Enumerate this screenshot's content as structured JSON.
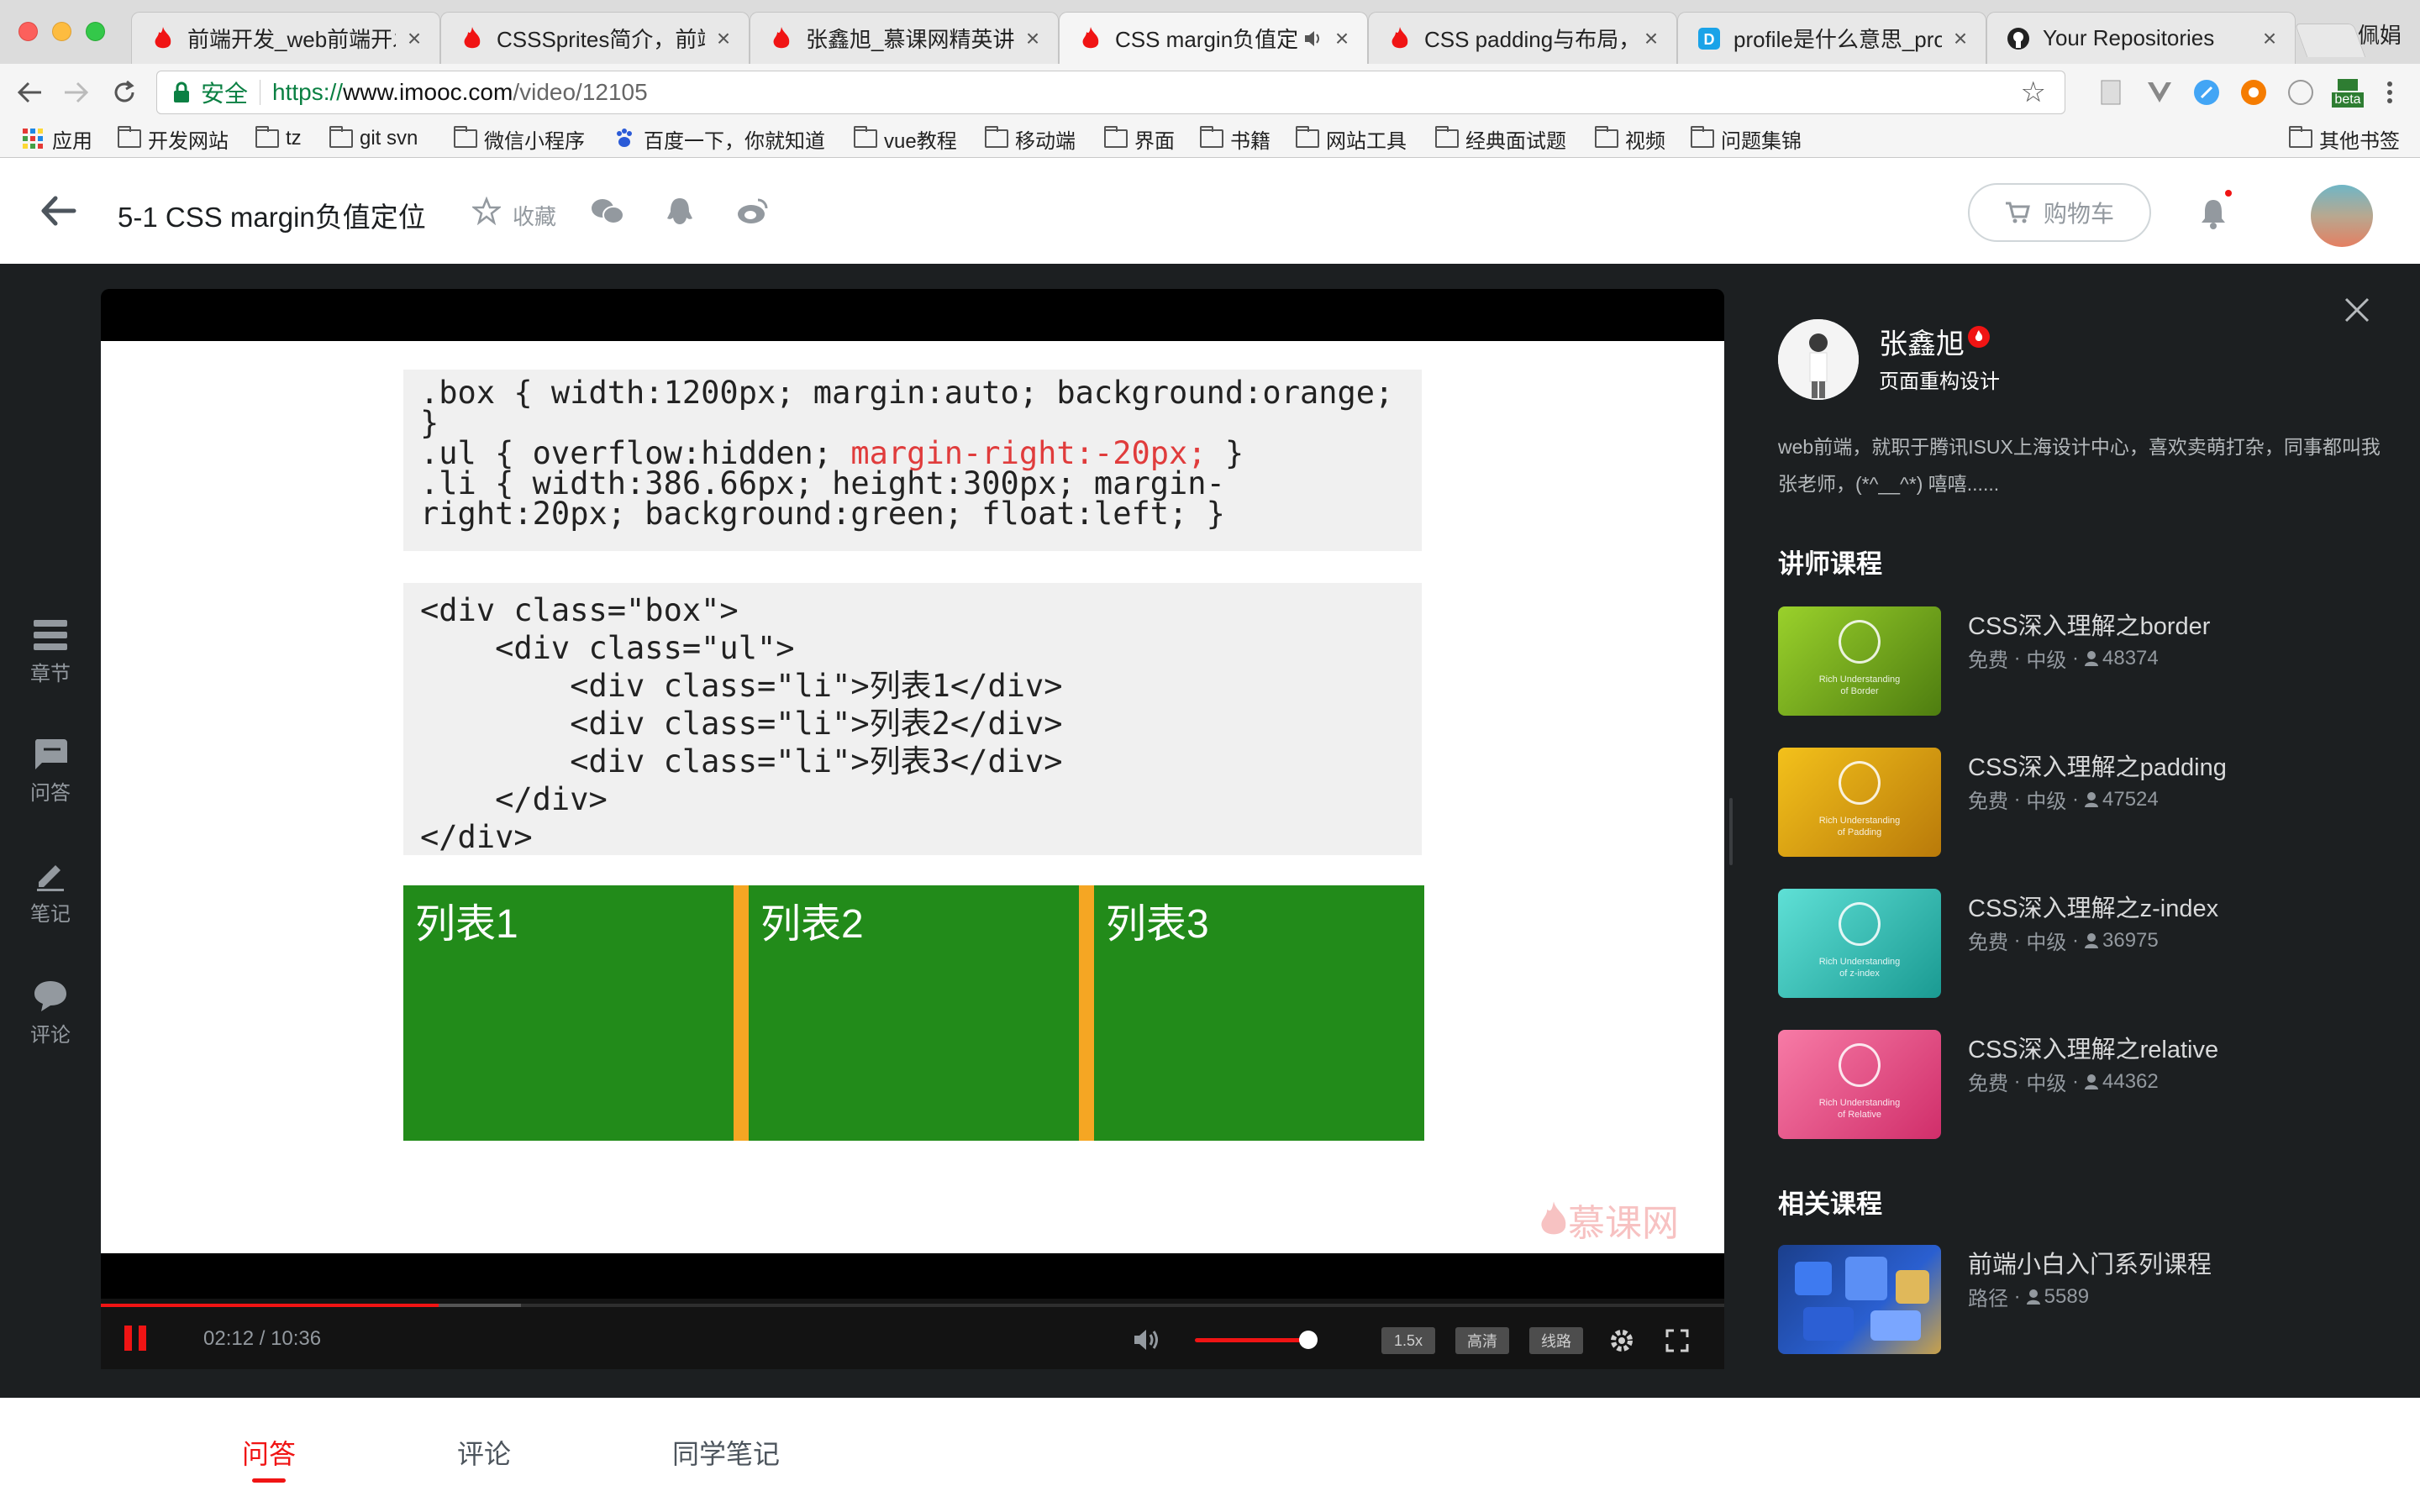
{
  "browser": {
    "tabs": [
      {
        "title": "前端开发_web前端开发",
        "favicon": "imooc-flame-icon"
      },
      {
        "title": "CSSSprites简介，前端",
        "favicon": "imooc-flame-icon"
      },
      {
        "title": "张鑫旭_慕课网精英讲师",
        "favicon": "imooc-flame-icon"
      },
      {
        "title": "CSS margin负值定位",
        "favicon": "imooc-flame-icon",
        "active": true,
        "audio": "speaker-icon"
      },
      {
        "title": "CSS padding与布局，C",
        "favicon": "imooc-flame-icon"
      },
      {
        "title": "profile是什么意思_profi",
        "favicon": "dict-icon"
      },
      {
        "title": "Your Repositories",
        "favicon": "github-icon"
      }
    ],
    "tab_close": "×",
    "profile_name": "佩娟",
    "address": {
      "secure_label": "安全",
      "scheme": "https://",
      "host": "www.imooc.com",
      "path": "/video/12105"
    },
    "extension_badge": "beta",
    "bookmarks": [
      {
        "label": "应用",
        "icon": "apps-grid-icon"
      },
      {
        "label": "开发网站",
        "icon": "folder-icon"
      },
      {
        "label": "tz",
        "icon": "folder-icon"
      },
      {
        "label": "git svn",
        "icon": "folder-icon"
      },
      {
        "label": "微信小程序",
        "icon": "folder-icon"
      },
      {
        "label": "百度一下，你就知道",
        "icon": "baidu-paw-icon"
      },
      {
        "label": "vue教程",
        "icon": "folder-icon"
      },
      {
        "label": "移动端",
        "icon": "folder-icon"
      },
      {
        "label": "界面",
        "icon": "folder-icon"
      },
      {
        "label": "书籍",
        "icon": "folder-icon"
      },
      {
        "label": "网站工具",
        "icon": "folder-icon"
      },
      {
        "label": "经典面试题",
        "icon": "folder-icon"
      },
      {
        "label": "视频",
        "icon": "folder-icon"
      },
      {
        "label": "问题集锦",
        "icon": "folder-icon"
      }
    ],
    "other_bookmarks": "其他书签"
  },
  "header": {
    "course_title": "5-1 CSS margin负值定位",
    "collect_label": "收藏",
    "cart_label": "购物车"
  },
  "sidebar": {
    "items": [
      {
        "label": "章节",
        "icon": "chapters-icon"
      },
      {
        "label": "问答",
        "icon": "qa-icon"
      },
      {
        "label": "笔记",
        "icon": "note-pen-icon"
      },
      {
        "label": "评论",
        "icon": "comment-bubble-icon"
      }
    ]
  },
  "slide": {
    "code_css": {
      "line1": ".box { width:1200px; margin:auto; background:orange;",
      "line2": "}",
      "line3_pre": ".ul { overflow:hidden; ",
      "line3_red": "margin-right:-20px;",
      "line3_post": " }",
      "line4": ".li { width:386.66px; height:300px; margin-",
      "line5": "right:20px; background:green; float:left; }"
    },
    "code_html": {
      "line1": "<div class=\"box\">",
      "line2": "    <div class=\"ul\">",
      "line3": "        <div class=\"li\">列表1</div>",
      "line4": "        <div class=\"li\">列表2</div>",
      "line5": "        <div class=\"li\">列表3</div>",
      "line6": "    </div>",
      "line7": "</div>"
    },
    "demo_items": [
      "列表1",
      "列表2",
      "列表3"
    ],
    "watermark": "慕课网"
  },
  "player": {
    "time_current": "02:12",
    "time_total": "10:36",
    "time_display": "02:12 / 10:36",
    "progress_fraction": 0.208,
    "volume_fraction": 0.9,
    "speed_label": "1.5x",
    "quality_label": "高清",
    "route_label": "线路"
  },
  "teacher": {
    "name": "张鑫旭",
    "role": "页面重构设计",
    "bio": "web前端，就职于腾讯ISUX上海设计中心，喜欢卖萌打杂，同事都叫我张老师，(*^__^*) 嘻嘻......"
  },
  "teacher_courses": {
    "heading": "讲师课程",
    "items": [
      {
        "name": "CSS深入理解之border",
        "price": "免费",
        "level": "中级",
        "students": "48374",
        "thumb_line1": "Rich Understanding",
        "thumb_line2": "of Border",
        "thumb_color": "#7cb518"
      },
      {
        "name": "CSS深入理解之padding",
        "price": "免费",
        "level": "中级",
        "students": "47524",
        "thumb_line1": "Rich Understanding",
        "thumb_line2": "of Padding",
        "thumb_color": "#e5a413"
      },
      {
        "name": "CSS深入理解之z-index",
        "price": "免费",
        "level": "中级",
        "students": "36975",
        "thumb_line1": "Rich Understanding",
        "thumb_line2": "of z-index",
        "thumb_color": "#39c6bd"
      },
      {
        "name": "CSS深入理解之relative",
        "price": "免费",
        "level": "中级",
        "students": "44362",
        "thumb_line1": "Rich Understanding",
        "thumb_line2": "of Relative",
        "thumb_color": "#ea4f86"
      }
    ]
  },
  "related_courses": {
    "heading": "相关课程",
    "items": [
      {
        "name": "前端小白入门系列课程",
        "type": "路径",
        "students": "5589"
      }
    ]
  },
  "bottom_tabs": [
    {
      "label": "问答",
      "active": true
    },
    {
      "label": "评论"
    },
    {
      "label": "同学笔记"
    }
  ],
  "colors": {
    "accent_red": "#f01414",
    "stage_bg": "#1c1f21",
    "demo_green": "#228b1a",
    "demo_orange": "#f5a623"
  }
}
